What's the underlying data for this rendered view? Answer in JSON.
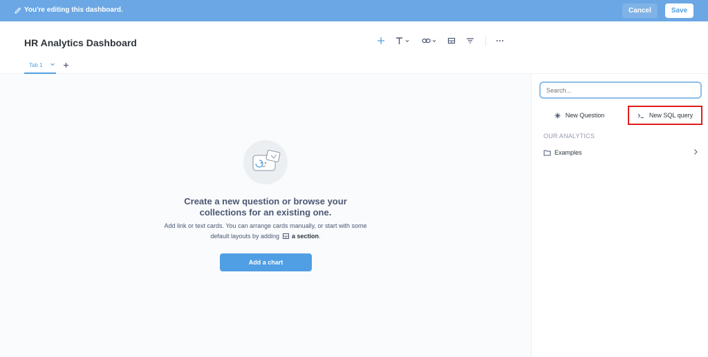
{
  "edit_bar": {
    "message": "You're editing this dashboard.",
    "cancel_label": "Cancel",
    "save_label": "Save"
  },
  "dashboard": {
    "title": "HR Analytics Dashboard"
  },
  "tabs": [
    {
      "label": "Tab 1",
      "active": true
    }
  ],
  "toolbar": {
    "icons": [
      "plus-icon",
      "text-icon",
      "link-icon",
      "section-icon",
      "filter-icon",
      "more-icon"
    ]
  },
  "empty_state": {
    "title": "Create a new question or browse your collections for an existing one.",
    "subtitle_part1": "Add link or text cards. You can arrange cards manually, or start with some default layouts by adding",
    "subtitle_bold": "a section",
    "subtitle_end": ".",
    "add_chart_label": "Add a chart"
  },
  "sidebar": {
    "search_placeholder": "Search...",
    "new_question_label": "New Question",
    "new_sql_label": "New SQL query",
    "section_heading": "OUR ANALYTICS",
    "collections": [
      {
        "label": "Examples"
      }
    ]
  },
  "colors": {
    "brand": "#509ee3",
    "edit_bar": "#6ba7e4",
    "highlight": "#e11b1b"
  }
}
